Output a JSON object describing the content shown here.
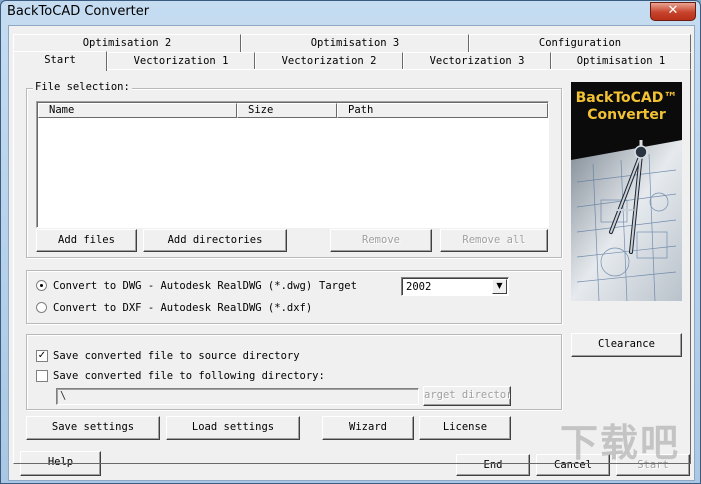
{
  "window": {
    "title": "BackToCAD Converter",
    "close_label": "✕"
  },
  "tabs": {
    "row_back": [
      "Optimisation 2",
      "Optimisation 3",
      "Configuration"
    ],
    "row_front": [
      "Start",
      "Vectorization 1",
      "Vectorization 2",
      "Vectorization 3",
      "Optimisation 1"
    ],
    "active": "Start"
  },
  "file_selection": {
    "legend": "File selection:",
    "columns": [
      "Name",
      "Size",
      "Path"
    ],
    "add_files": "Add files",
    "add_directories": "Add directories",
    "remove": "Remove",
    "remove_all": "Remove all"
  },
  "convert": {
    "dwg_label": "Convert to DWG - Autodesk RealDWG (*.dwg)",
    "dxf_label": "Convert to DXF - Autodesk RealDWG (*.dxf)",
    "selected": "dwg",
    "target_label": "Target",
    "target_value": "2002"
  },
  "output": {
    "save_source_label": "Save converted file to source directory",
    "save_source_checked": true,
    "save_following_label": "Save converted file to following directory:",
    "save_following_checked": false,
    "directory_value": "\\",
    "target_directory_button": "arget director"
  },
  "actions": {
    "save_settings": "Save settings",
    "load_settings": "Load settings",
    "wizard": "Wizard",
    "license": "License",
    "clearance": "Clearance"
  },
  "footer": {
    "help": "Help",
    "end": "End",
    "cancel": "Cancel",
    "start": "Start"
  },
  "logo": {
    "line1": "BackToCAD™",
    "line2": "Converter"
  },
  "watermark": "下载吧"
}
